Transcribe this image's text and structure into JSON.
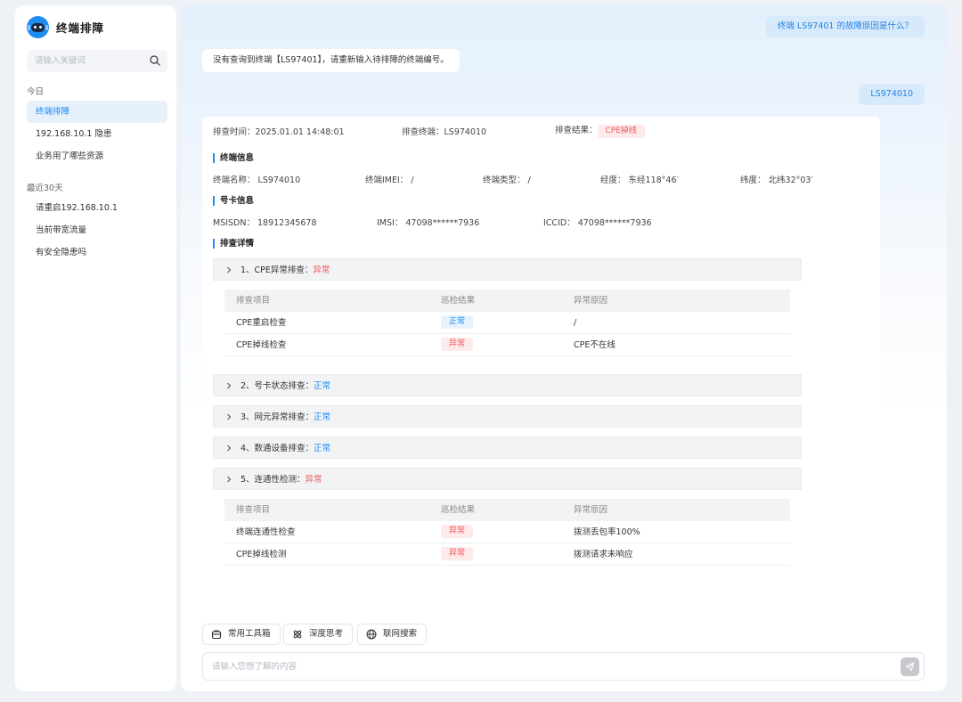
{
  "app": {
    "name": "终端排障"
  },
  "search": {
    "placeholder": "请输入关键词"
  },
  "sidebar": {
    "today_label": "今日",
    "today_items": [
      {
        "label": "终端排障",
        "active": true
      },
      {
        "label": "192.168.10.1 隐患"
      },
      {
        "label": "业务用了哪些资源"
      }
    ],
    "recent_label": "最近30天",
    "recent_items": [
      {
        "label": "请重启192.168.10.1"
      },
      {
        "label": "当前带宽流量"
      },
      {
        "label": "有安全隐患吗"
      }
    ]
  },
  "chat": {
    "user_msg_1": "终端 LS97401 的故障原因是什么？",
    "bot_msg_1": "没有查询到终端【LS97401】，请重新输入待排障的终端编号。",
    "user_msg_2": "LS974010"
  },
  "result": {
    "time_label": "排查时间：",
    "time_value": "2025.01.01 14:48:01",
    "terminal_label": "排查终端：",
    "terminal_value": "LS974010",
    "result_label": "排查结果：",
    "result_value": "CPE掉线",
    "terminal_info_title": "终端信息",
    "terminal_info": {
      "name": "终端名称：  LS974010",
      "imei": "终端IMEI：  /",
      "type": "终端类型：  /",
      "lng": "经度：  东经118°46′",
      "lat": "纬度：  北纬32°03′"
    },
    "card_info_title": "号卡信息",
    "card_info": {
      "msisdn": "MSISDN：  18912345678",
      "imsi": "IMSI：  47098******7936",
      "iccid": "ICCID：  47098******7936"
    },
    "detail_title": "排查详情",
    "table_headers": [
      "排查项目",
      "巡检结果",
      "异常原因"
    ],
    "sections": [
      {
        "title": "1、CPE异常排查：",
        "status": "异常",
        "rows": [
          {
            "item": "CPE重启检查",
            "result": "正常",
            "reason": "/"
          },
          {
            "item": "CPE掉线检查",
            "result": "异常",
            "reason": "CPE不在线"
          }
        ]
      },
      {
        "title": "2、号卡状态排查：",
        "status": "正常"
      },
      {
        "title": "3、网元异常排查：",
        "status": "正常"
      },
      {
        "title": "4、数通设备排查：",
        "status": "正常"
      },
      {
        "title": "5、连通性检测：",
        "status": "异常",
        "rows": [
          {
            "item": "终端连通性检查",
            "result": "异常",
            "reason": "拨测丢包率100%"
          },
          {
            "item": "CPE掉线检测",
            "result": "异常",
            "reason": "拨测请求未响应"
          }
        ]
      }
    ]
  },
  "tools": {
    "toolbox": "常用工具箱",
    "deep_think": "深度思考",
    "web_search": "联网搜索"
  },
  "composer": {
    "placeholder": "请输入您想了解的内容"
  },
  "colors": {
    "accent": "#1f8cf0",
    "danger": "#f05a5a"
  }
}
